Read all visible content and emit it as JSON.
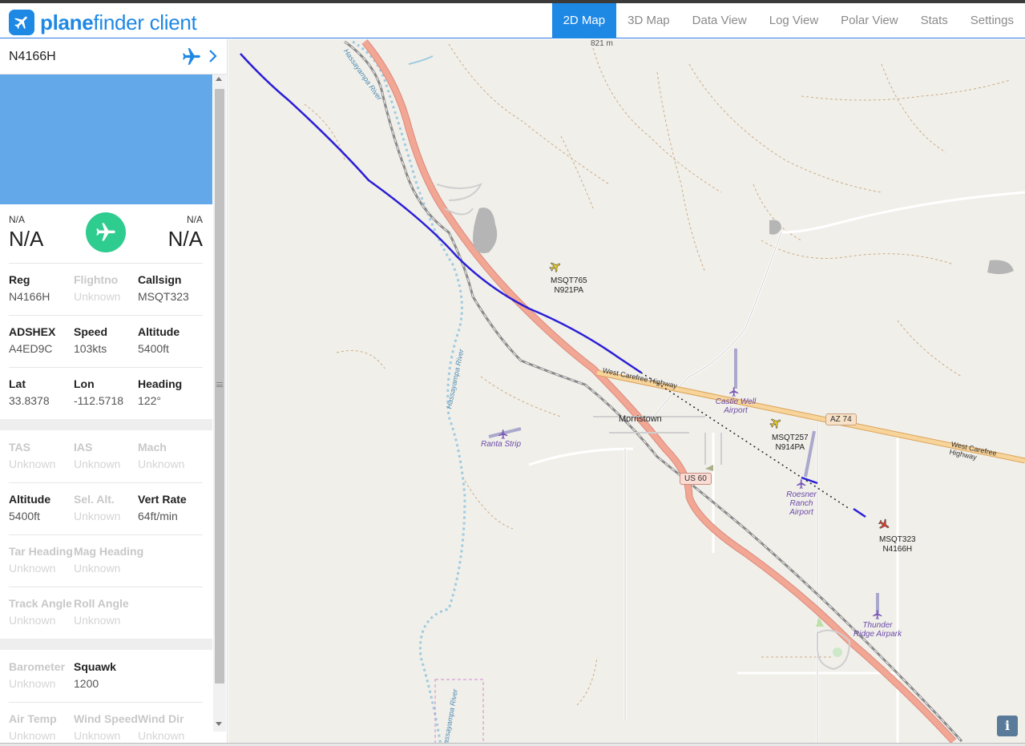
{
  "app": {
    "brand_bold": "plane",
    "brand_rest": "finder client"
  },
  "nav": {
    "tabs": [
      {
        "label": "2D Map",
        "active": true
      },
      {
        "label": "3D Map",
        "active": false
      },
      {
        "label": "Data View",
        "active": false
      },
      {
        "label": "Log View",
        "active": false
      },
      {
        "label": "Polar View",
        "active": false
      },
      {
        "label": "Stats",
        "active": false
      },
      {
        "label": "Settings",
        "active": false
      }
    ]
  },
  "sidebar": {
    "registration": "N4166H",
    "route": {
      "from_code": "N/A",
      "from_name": "N/A",
      "to_code": "N/A",
      "to_name": "N/A"
    },
    "fields": {
      "reg": {
        "label": "Reg",
        "value": "N4166H"
      },
      "flightno": {
        "label": "Flightno",
        "value": "Unknown"
      },
      "callsign": {
        "label": "Callsign",
        "value": "MSQT323"
      },
      "adshex": {
        "label": "ADSHEX",
        "value": "A4ED9C"
      },
      "speed": {
        "label": "Speed",
        "value": "103kts"
      },
      "altitude": {
        "label": "Altitude",
        "value": "5400ft"
      },
      "lat": {
        "label": "Lat",
        "value": "33.8378"
      },
      "lon": {
        "label": "Lon",
        "value": "-112.5718"
      },
      "heading": {
        "label": "Heading",
        "value": "122°"
      },
      "tas": {
        "label": "TAS",
        "value": "Unknown"
      },
      "ias": {
        "label": "IAS",
        "value": "Unknown"
      },
      "mach": {
        "label": "Mach",
        "value": "Unknown"
      },
      "altitude2": {
        "label": "Altitude",
        "value": "5400ft"
      },
      "sel_alt": {
        "label": "Sel. Alt.",
        "value": "Unknown"
      },
      "vert_rate": {
        "label": "Vert Rate",
        "value": "64ft/min"
      },
      "tar_heading": {
        "label": "Tar Heading",
        "value": "Unknown"
      },
      "mag_heading": {
        "label": "Mag Heading",
        "value": "Unknown"
      },
      "track_angle": {
        "label": "Track Angle",
        "value": "Unknown"
      },
      "roll_angle": {
        "label": "Roll Angle",
        "value": "Unknown"
      },
      "barometer": {
        "label": "Barometer",
        "value": "Unknown"
      },
      "squawk": {
        "label": "Squawk",
        "value": "1200"
      },
      "air_temp": {
        "label": "Air Temp",
        "value": "Unknown"
      },
      "wind_speed": {
        "label": "Wind Speed",
        "value": "Unknown"
      },
      "wind_dir": {
        "label": "Wind Dir",
        "value": "Unknown"
      }
    }
  },
  "map": {
    "elevation_label": "821 m",
    "places": {
      "morristown": "Morristown"
    },
    "roads": {
      "carefree_west": "West Carefree Highway",
      "carefree_east": "West Carefree Highway",
      "az74": "AZ 74",
      "us60": "US 60"
    },
    "rivers": {
      "hassayampa_top": "Hassayampa River",
      "hassayampa_mid": "Hassayampa River",
      "hassayampa_bottom": "Hassayampa River"
    },
    "airports": {
      "castle_well_1": "Castle Well",
      "castle_well_2": "Airport",
      "ranta": "Ranta Strip",
      "roesner_1": "Roesner",
      "roesner_2": "Ranch",
      "roesner_3": "Airport",
      "thunder_1": "Thunder",
      "thunder_2": "Ridge Airpark"
    },
    "aircraft": {
      "a1_callsign": "MSQT765",
      "a1_reg": "N921PA",
      "a2_callsign": "MSQT257",
      "a2_reg": "N914PA",
      "a3_callsign": "MSQT323",
      "a3_reg": "N4166H"
    },
    "info_button": "i",
    "colors": {
      "track": "#2a1fd6",
      "highway": "#e8968a",
      "state_road": "#f5c98a",
      "river": "#9ecbe0",
      "airport": "#7a5bb8"
    }
  }
}
